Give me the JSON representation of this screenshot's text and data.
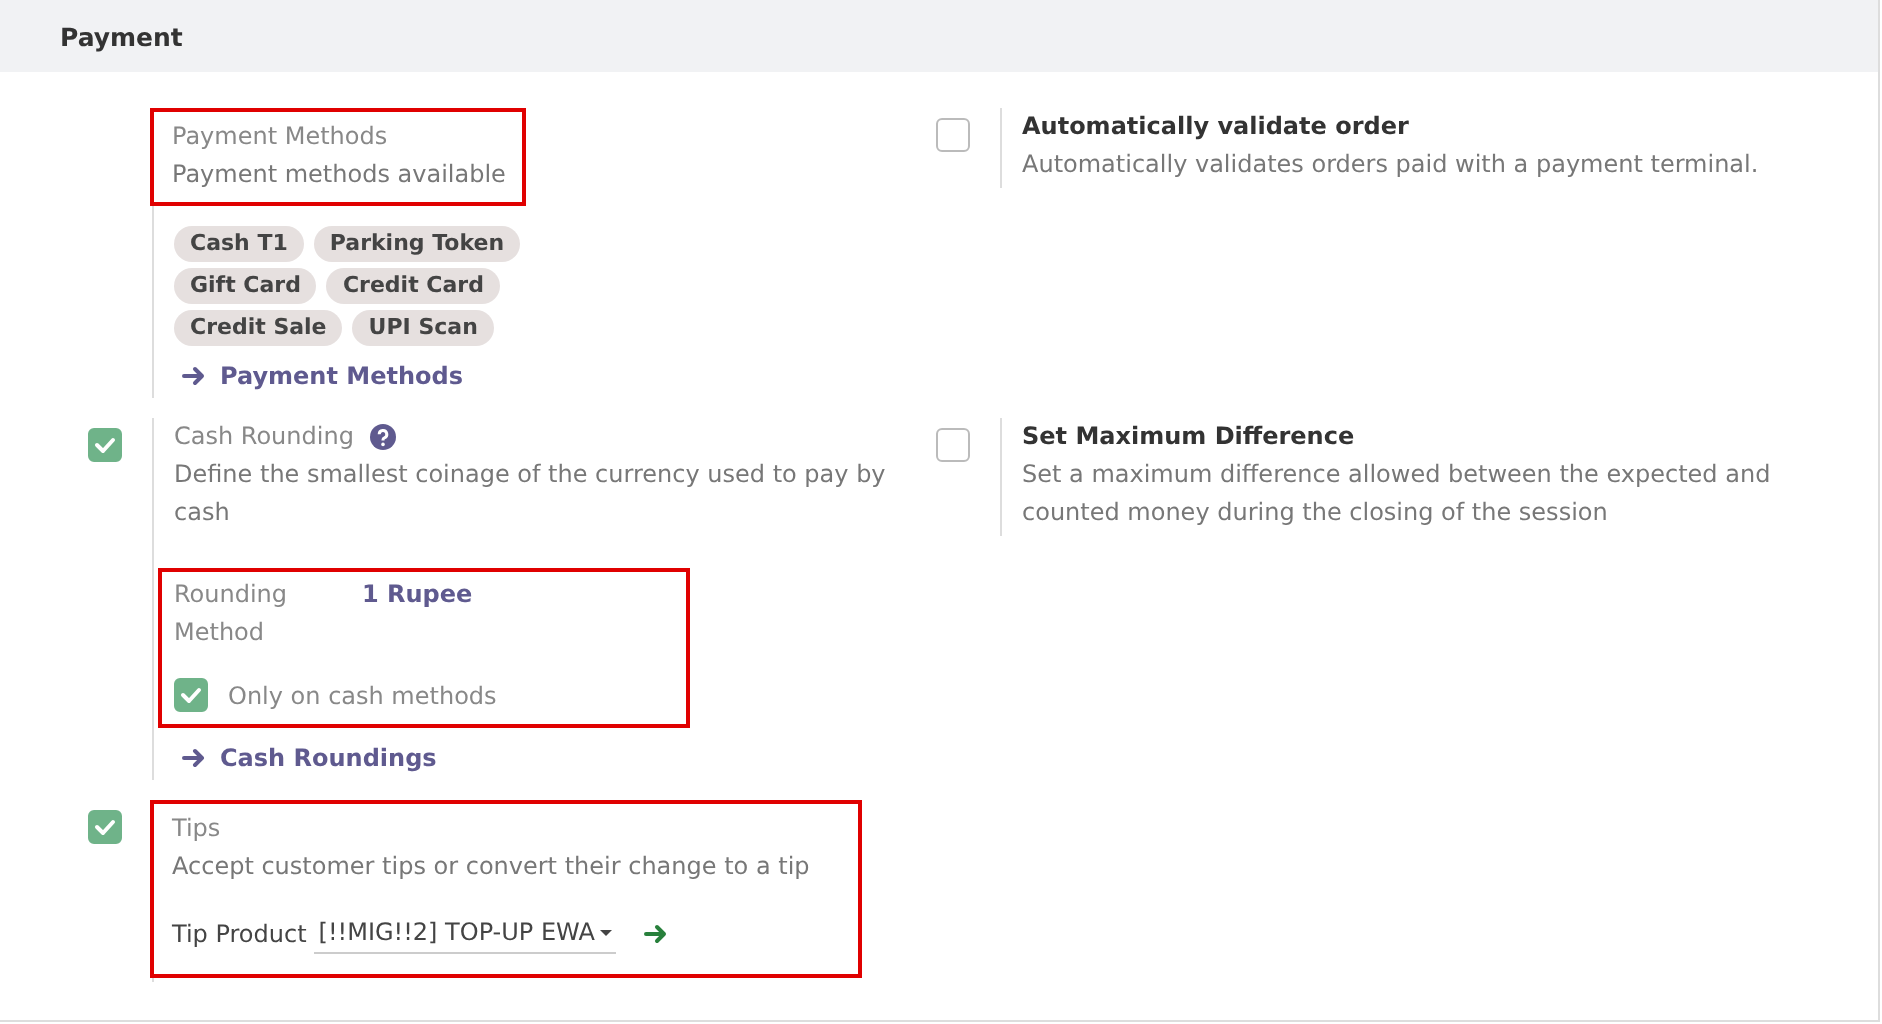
{
  "section_title": "Payment",
  "rows": [
    {
      "left": {
        "title": "Payment Methods",
        "title_muted": true,
        "help": false,
        "description": "Payment methods available",
        "header_highlighted": true,
        "highlighted": false,
        "extras": [
          {
            "kind": "tags",
            "tags": [
              "Cash T1",
              "Parking Token",
              "Gift Card",
              "Credit Card",
              "Credit Sale",
              "UPI Scan"
            ]
          },
          {
            "kind": "link",
            "label": "Payment Methods"
          }
        ]
      },
      "right": {
        "checkbox": {
          "checked": false
        },
        "title": "Automatically validate order",
        "title_muted": false,
        "help": false,
        "description": "Automatically validates orders paid with a payment terminal.",
        "header_highlighted": false,
        "highlighted": false
      }
    },
    {
      "left": {
        "checkbox": {
          "checked": true
        },
        "title": "Cash Rounding",
        "title_muted": true,
        "help": true,
        "description": "Define the smallest coinage of the currency used to pay by cash",
        "header_highlighted": false,
        "highlighted": false,
        "extras": [
          {
            "kind": "group",
            "highlighted": true,
            "field_label": "Rounding Method",
            "field_value": "1 Rupee",
            "option": {
              "label": "Only on cash methods",
              "checked": true
            }
          },
          {
            "kind": "link",
            "label": "Cash Roundings"
          }
        ]
      },
      "right": {
        "checkbox": {
          "checked": false
        },
        "title": "Set Maximum Difference",
        "title_muted": false,
        "help": false,
        "description": "Set a maximum difference allowed between the expected and counted money during the closing of the session",
        "header_highlighted": false,
        "highlighted": false
      }
    },
    {
      "left": {
        "checkbox": {
          "checked": true
        },
        "title": "Tips",
        "title_muted": true,
        "help": false,
        "description": "Accept customer tips or convert their change to a tip",
        "header_highlighted": false,
        "highlighted": true,
        "extras": [
          {
            "kind": "select",
            "label": "Tip Product",
            "value": "[!!MIG!!2] TOP-UP EWA"
          }
        ]
      }
    }
  ]
}
